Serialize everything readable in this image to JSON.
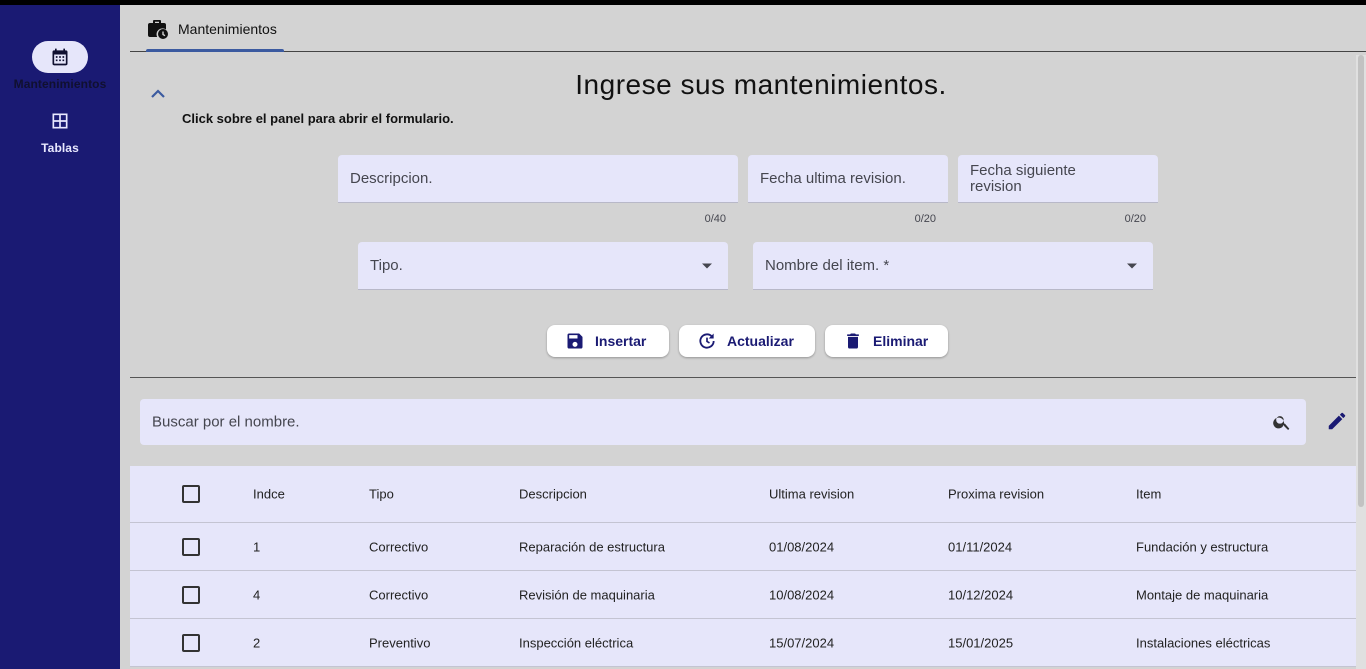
{
  "nav": {
    "items": [
      {
        "label": "Mantenimientos",
        "icon": "calendar-icon",
        "active": true
      },
      {
        "label": "Tablas",
        "icon": "grid-icon",
        "active": false
      }
    ]
  },
  "tabs": [
    {
      "label": "Mantenimientos",
      "icon": "maintenance-bag-icon"
    }
  ],
  "form": {
    "title": "Ingrese sus mantenimientos.",
    "subtitle": "Click sobre el panel para abrir el formulario.",
    "descripcion": {
      "placeholder": "Descripcion.",
      "counter": "0/40"
    },
    "fecha_ultima": {
      "placeholder": "Fecha ultima revision.",
      "counter": "0/20"
    },
    "fecha_siguiente": {
      "placeholder": "Fecha siguiente revision",
      "counter": "0/20"
    },
    "tipo": {
      "placeholder": "Tipo."
    },
    "nombre_item": {
      "placeholder": "Nombre del item. *"
    },
    "buttons": {
      "insertar": "Insertar",
      "actualizar": "Actualizar",
      "eliminar": "Eliminar"
    }
  },
  "search": {
    "placeholder": "Buscar por el nombre."
  },
  "table": {
    "headers": [
      "Indce",
      "Tipo",
      "Descripcion",
      "Ultima revision",
      "Proxima revision",
      "Item"
    ],
    "rows": [
      [
        "1",
        "Correctivo",
        "Reparación de estructura",
        "01/08/2024",
        "01/11/2024",
        "Fundación y estructura"
      ],
      [
        "4",
        "Correctivo",
        "Revisión de maquinaria",
        "10/08/2024",
        "10/12/2024",
        "Montaje de maquinaria"
      ],
      [
        "2",
        "Preventivo",
        "Inspección eléctrica",
        "15/07/2024",
        "15/01/2025",
        "Instalaciones eléctricas"
      ]
    ]
  },
  "colors": {
    "sidebar": "#1a1a73",
    "accent": "#1a1a73",
    "field": "#e6e6fa",
    "background": "#d3d3d3"
  }
}
